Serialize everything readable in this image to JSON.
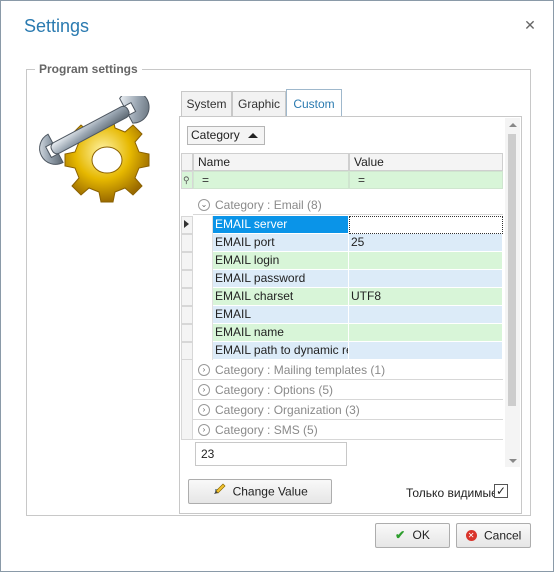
{
  "window": {
    "title": "Settings",
    "close_icon": "close-icon"
  },
  "group": {
    "legend": "Program settings"
  },
  "tabs": [
    {
      "label": "System",
      "active": false
    },
    {
      "label": "Graphic",
      "active": false
    },
    {
      "label": "Custom",
      "active": true
    }
  ],
  "group_by": {
    "value": "Category"
  },
  "grid": {
    "columns": [
      "Name",
      "Value"
    ],
    "filter_symbols": [
      "=",
      "="
    ],
    "expanded_category": "Category : Email (8)",
    "rows": [
      {
        "name": "EMAIL server",
        "value": "",
        "selected": true
      },
      {
        "name": "EMAIL port",
        "value": "25"
      },
      {
        "name": "EMAIL login",
        "value": ""
      },
      {
        "name": "EMAIL password",
        "value": ""
      },
      {
        "name": "EMAIL charset",
        "value": "UTF8"
      },
      {
        "name": "EMAIL",
        "value": ""
      },
      {
        "name": "EMAIL name",
        "value": ""
      },
      {
        "name": "EMAIL path to dynamic repo",
        "value": ""
      }
    ],
    "collapsed_categories": [
      "Category : Mailing templates (1)",
      "Category : Options (5)",
      "Category : Organization (3)",
      "Category : SMS (5)"
    ]
  },
  "footer": {
    "count": "23",
    "change_value_label": "Change Value",
    "only_visible_label": "Только видимые",
    "only_visible_checked": true
  },
  "buttons": {
    "ok": "OK",
    "cancel": "Cancel"
  },
  "colors": {
    "accent": "#2a7ab0",
    "selection": "#0a94e8",
    "row_green": "#d8f5d8",
    "row_blue": "#dcebf8"
  }
}
